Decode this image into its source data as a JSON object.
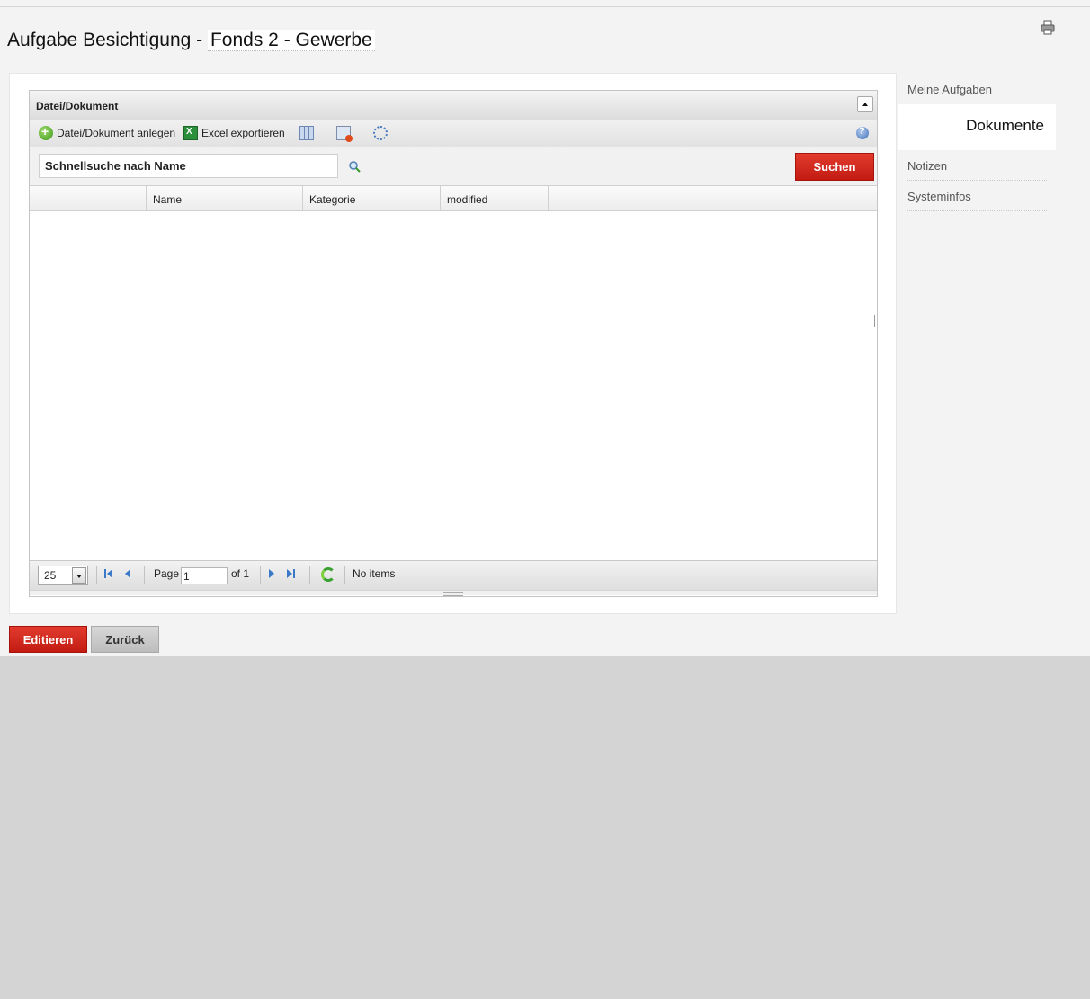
{
  "page": {
    "title_prefix": "Aufgabe Besichtigung - ",
    "title_link": "Fonds 2 - Gewerbe"
  },
  "grid": {
    "title": "Datei/Dokument",
    "toolbar": {
      "add_label": "Datei/Dokument anlegen",
      "export_label": "Excel exportieren"
    },
    "search": {
      "value": "Schnellsuche nach Name",
      "button_label": "Suchen"
    },
    "columns": [
      "",
      "Name",
      "Kategorie",
      "modified"
    ],
    "pager": {
      "page_size": "25",
      "page_label": "Page",
      "page_value": "1",
      "of_label": "of 1",
      "status": "No items"
    }
  },
  "side_menu": {
    "items": [
      {
        "label": "Meine Aufgaben"
      },
      {
        "label": "Dokumente"
      },
      {
        "label": "Notizen"
      },
      {
        "label": "Systeminfos"
      }
    ]
  },
  "actions": {
    "edit_label": "Editieren",
    "back_label": "Zurück"
  },
  "colors": {
    "accent_red": "#c21b12",
    "page_bg": "#f3f3f3",
    "footer_bg": "#d4d4d4"
  }
}
